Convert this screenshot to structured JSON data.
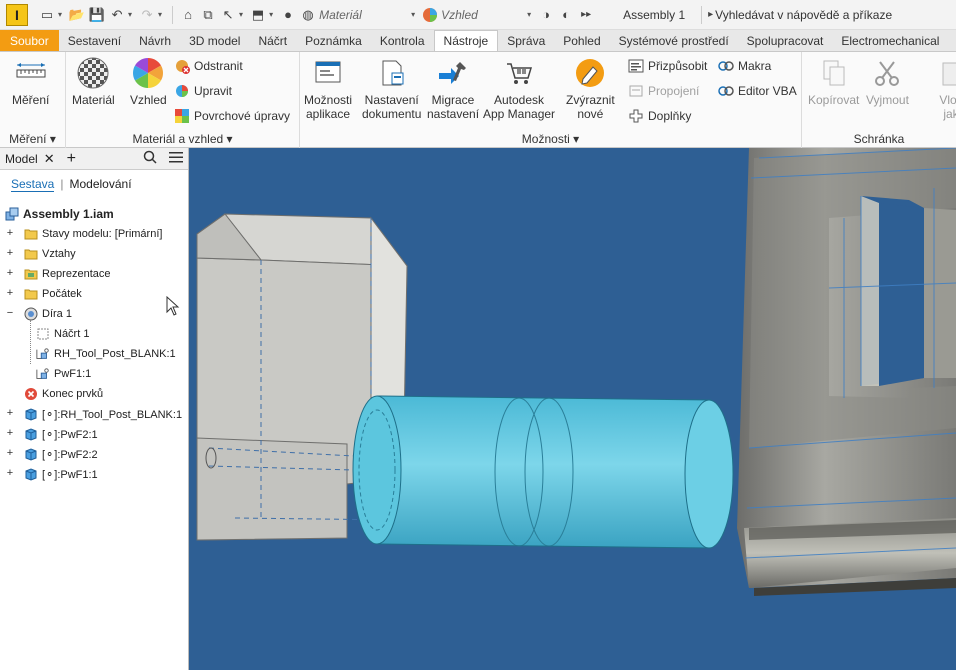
{
  "qat": {
    "logo": "I",
    "material_combo": "Materiál",
    "appearance_combo": "Vzhled",
    "doc_title": "Assembly 1",
    "search_placeholder": "Vyhledávat v nápovědě a příkaze"
  },
  "tabs": [
    {
      "label": "Soubor",
      "state": "file"
    },
    {
      "label": "Sestavení"
    },
    {
      "label": "Návrh"
    },
    {
      "label": "3D model"
    },
    {
      "label": "Náčrt"
    },
    {
      "label": "Poznámka"
    },
    {
      "label": "Kontrola"
    },
    {
      "label": "Nástroje",
      "state": "active"
    },
    {
      "label": "Správa"
    },
    {
      "label": "Pohled"
    },
    {
      "label": "Systémové prostředí"
    },
    {
      "label": "Spolupracovat"
    },
    {
      "label": "Electromechanical"
    }
  ],
  "ribbon": {
    "measure": {
      "btn": "Měření",
      "group": "Měření"
    },
    "material": {
      "material_btn": "Materiál",
      "appearance_btn": "Vzhled",
      "remove": "Odstranit",
      "edit": "Upravit",
      "surface": "Povrchové úpravy",
      "group": "Materiál a vzhled"
    },
    "options": {
      "app_options_1": "Možnosti",
      "app_options_2": "aplikace",
      "doc_settings_1": "Nastavení",
      "doc_settings_2": "dokumentu",
      "migrate_1": "Migrace",
      "migrate_2": "nastavení",
      "appmgr_1": "Autodesk",
      "appmgr_2": "App Manager",
      "highlight_1": "Zvýraznit",
      "highlight_2": "nové",
      "customize": "Přizpůsobit",
      "connections": "Propojení",
      "addins": "Doplňky",
      "macros": "Makra",
      "vba": "Editor VBA",
      "group": "Možnosti"
    },
    "clipboard": {
      "copy": "Kopírovat",
      "cut": "Vyjmout",
      "paste_1": "Vlož",
      "paste_2": "jak",
      "group": "Schránka"
    }
  },
  "browser": {
    "tab_label": "Model",
    "view_assembly": "Sestava",
    "view_modeling": "Modelování",
    "tree": [
      {
        "label": "Assembly 1.iam",
        "icon": "assembly-icon",
        "expand": ""
      },
      {
        "label": "Stavy modelu: [Primární]",
        "icon": "folder-icon",
        "expand": "+"
      },
      {
        "label": "Vztahy",
        "icon": "folder-icon",
        "expand": "+"
      },
      {
        "label": "Reprezentace",
        "icon": "representation-icon",
        "expand": "+"
      },
      {
        "label": "Počátek",
        "icon": "folder-icon",
        "expand": "+"
      },
      {
        "label": "Díra 1",
        "icon": "hole-icon",
        "expand": "−"
      },
      {
        "label": "Náčrt 1",
        "icon": "sketch-icon",
        "expand": ""
      },
      {
        "label": "RH_Tool_Post_BLANK:1",
        "icon": "part-ref-icon",
        "expand": ""
      },
      {
        "label": "PwF1:1",
        "icon": "part-ref-icon",
        "expand": ""
      },
      {
        "label": "Konec prvků",
        "icon": "end-of-features-icon",
        "expand": ""
      },
      {
        "label": "[⚬]:RH_Tool_Post_BLANK:1",
        "icon": "part-icon",
        "expand": "+"
      },
      {
        "label": "[⚬]:PwF2:1",
        "icon": "part-icon",
        "expand": "+"
      },
      {
        "label": "[⚬]:PwF2:2",
        "icon": "part-icon",
        "expand": "+"
      },
      {
        "label": "[⚬]:PwF1:1",
        "icon": "part-icon",
        "expand": "+"
      }
    ]
  },
  "colors": {
    "viewport_bg": "#2e5f94",
    "file_tab": "#f39c12",
    "cylinder": "#5fc3dc"
  }
}
